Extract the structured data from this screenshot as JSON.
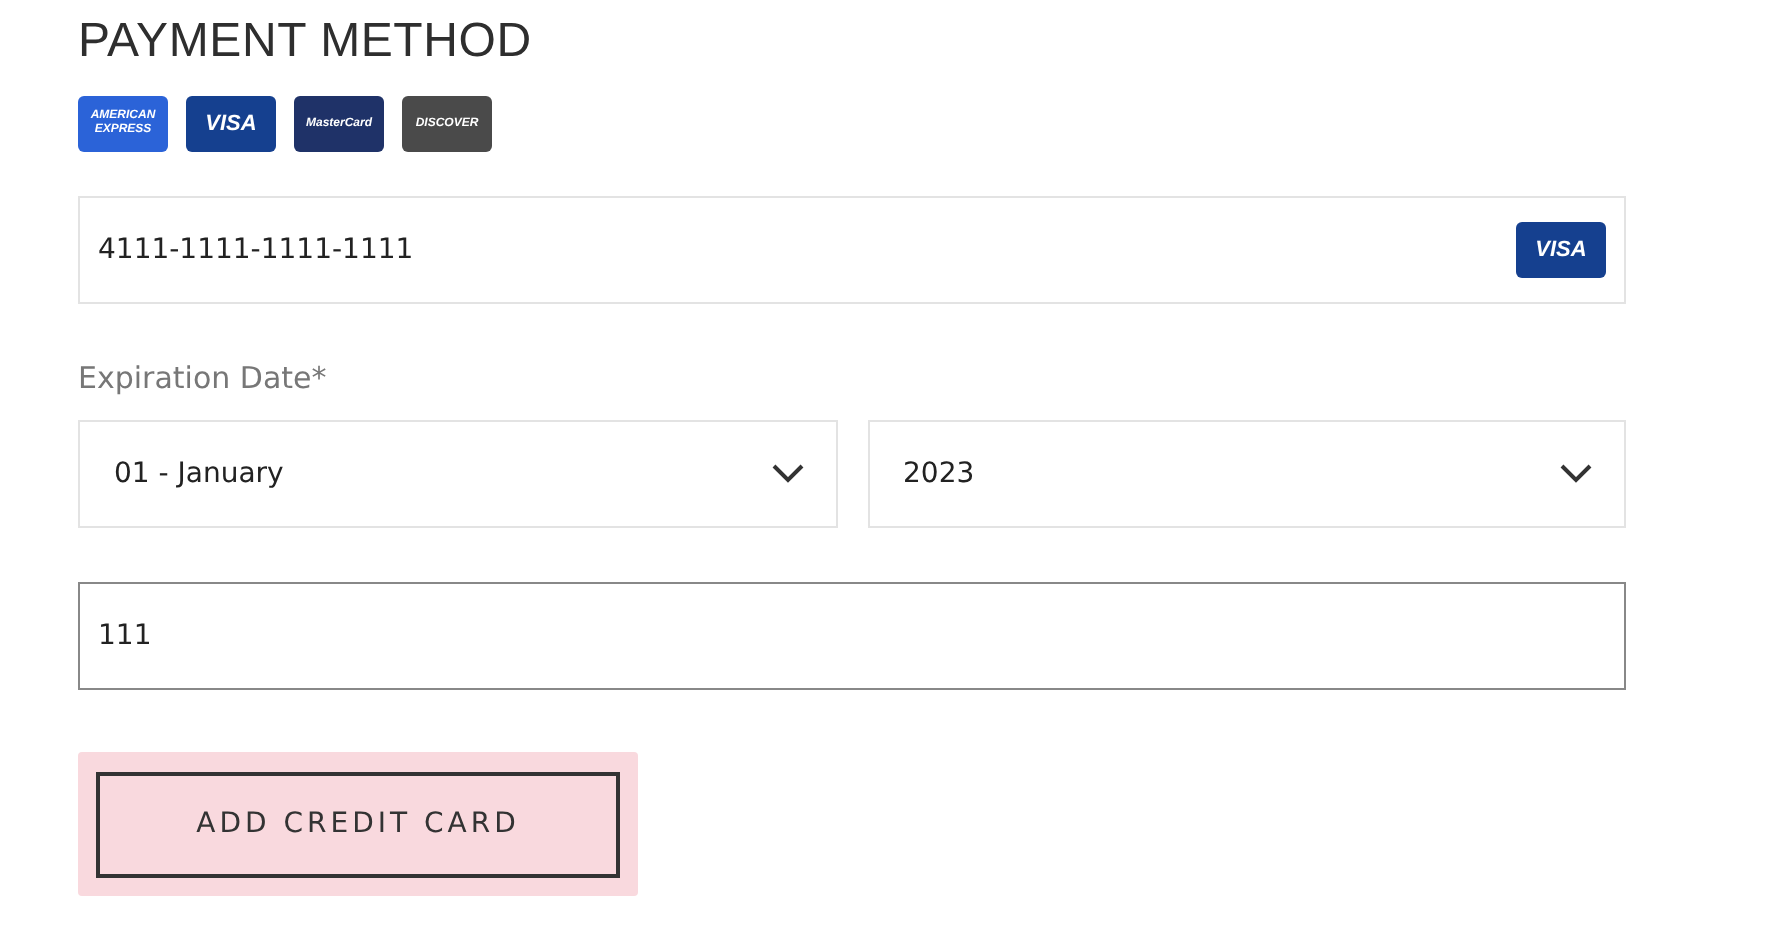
{
  "title": "PAYMENT METHOD",
  "card_logos": [
    {
      "kind": "amex",
      "label": "AMERICAN EXPRESS"
    },
    {
      "kind": "visa",
      "label": "VISA"
    },
    {
      "kind": "mastercard",
      "label": "MasterCard"
    },
    {
      "kind": "discover",
      "label": "DISCOVER"
    }
  ],
  "card_number": {
    "value": "4111-1111-1111-1111",
    "detected_logo": "VISA"
  },
  "expiration_label": "Expiration Date*",
  "expiration_selects": [
    {
      "value": "01 - January"
    },
    {
      "value": "2023"
    }
  ],
  "cvv": {
    "value": "111",
    "focused": true
  },
  "button": {
    "label": "ADD CREDIT CARD",
    "hovered": true
  }
}
